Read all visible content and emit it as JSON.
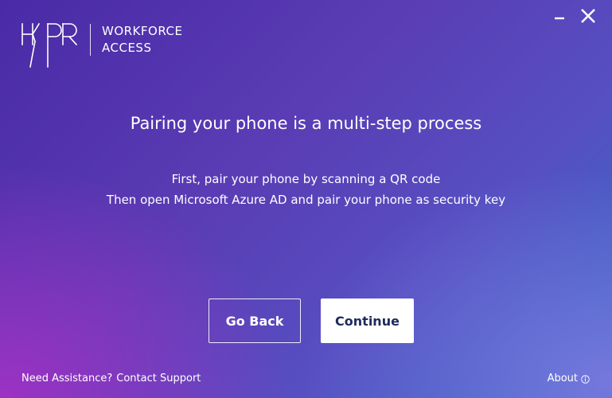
{
  "app": {
    "logo_text_line1": "WORKFORCE",
    "logo_text_line2": "ACCESS",
    "logo_icon": "hypr-logo"
  },
  "window_controls": {
    "minimize_icon": "minimize-icon",
    "close_icon": "close-icon"
  },
  "main": {
    "title": "Pairing your phone is a multi-step process",
    "line1": "First, pair your phone by scanning a QR code",
    "line2": "Then open Microsoft Azure AD and pair your phone as security key"
  },
  "buttons": {
    "back_label": "Go Back",
    "continue_label": "Continue"
  },
  "footer": {
    "assistance_label": "Need Assistance?",
    "support_link": "Contact Support",
    "about_label": "About",
    "about_icon": "info-icon"
  },
  "colors": {
    "text": "#ffffff",
    "continue_text": "#1f2a5c",
    "continue_bg": "#ffffff"
  }
}
